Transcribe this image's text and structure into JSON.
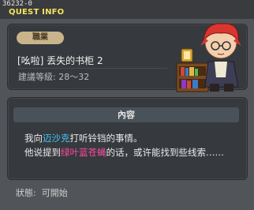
{
  "header": {
    "quest_id": "36232-0",
    "title": "QUEST INFO"
  },
  "quest": {
    "category": "職業",
    "name": "[吆啦] 丢失的书柜 2",
    "level": "建議等級: 28～32"
  },
  "content": {
    "header": "內容",
    "line1_before": "我向",
    "line1_npc": "迈沙克",
    "line1_after": "打听铃铛的事情。",
    "line2_before": "他说提到",
    "line2_mob": "绿叶蓝苍蝇",
    "line2_after": "的话，或许能找到些线索……"
  },
  "status": {
    "label": "狀態:",
    "value": "可開始"
  },
  "colors": {
    "npc": "#46c8ff",
    "mob": "#ff4aa0",
    "title": "#f3e35c"
  }
}
